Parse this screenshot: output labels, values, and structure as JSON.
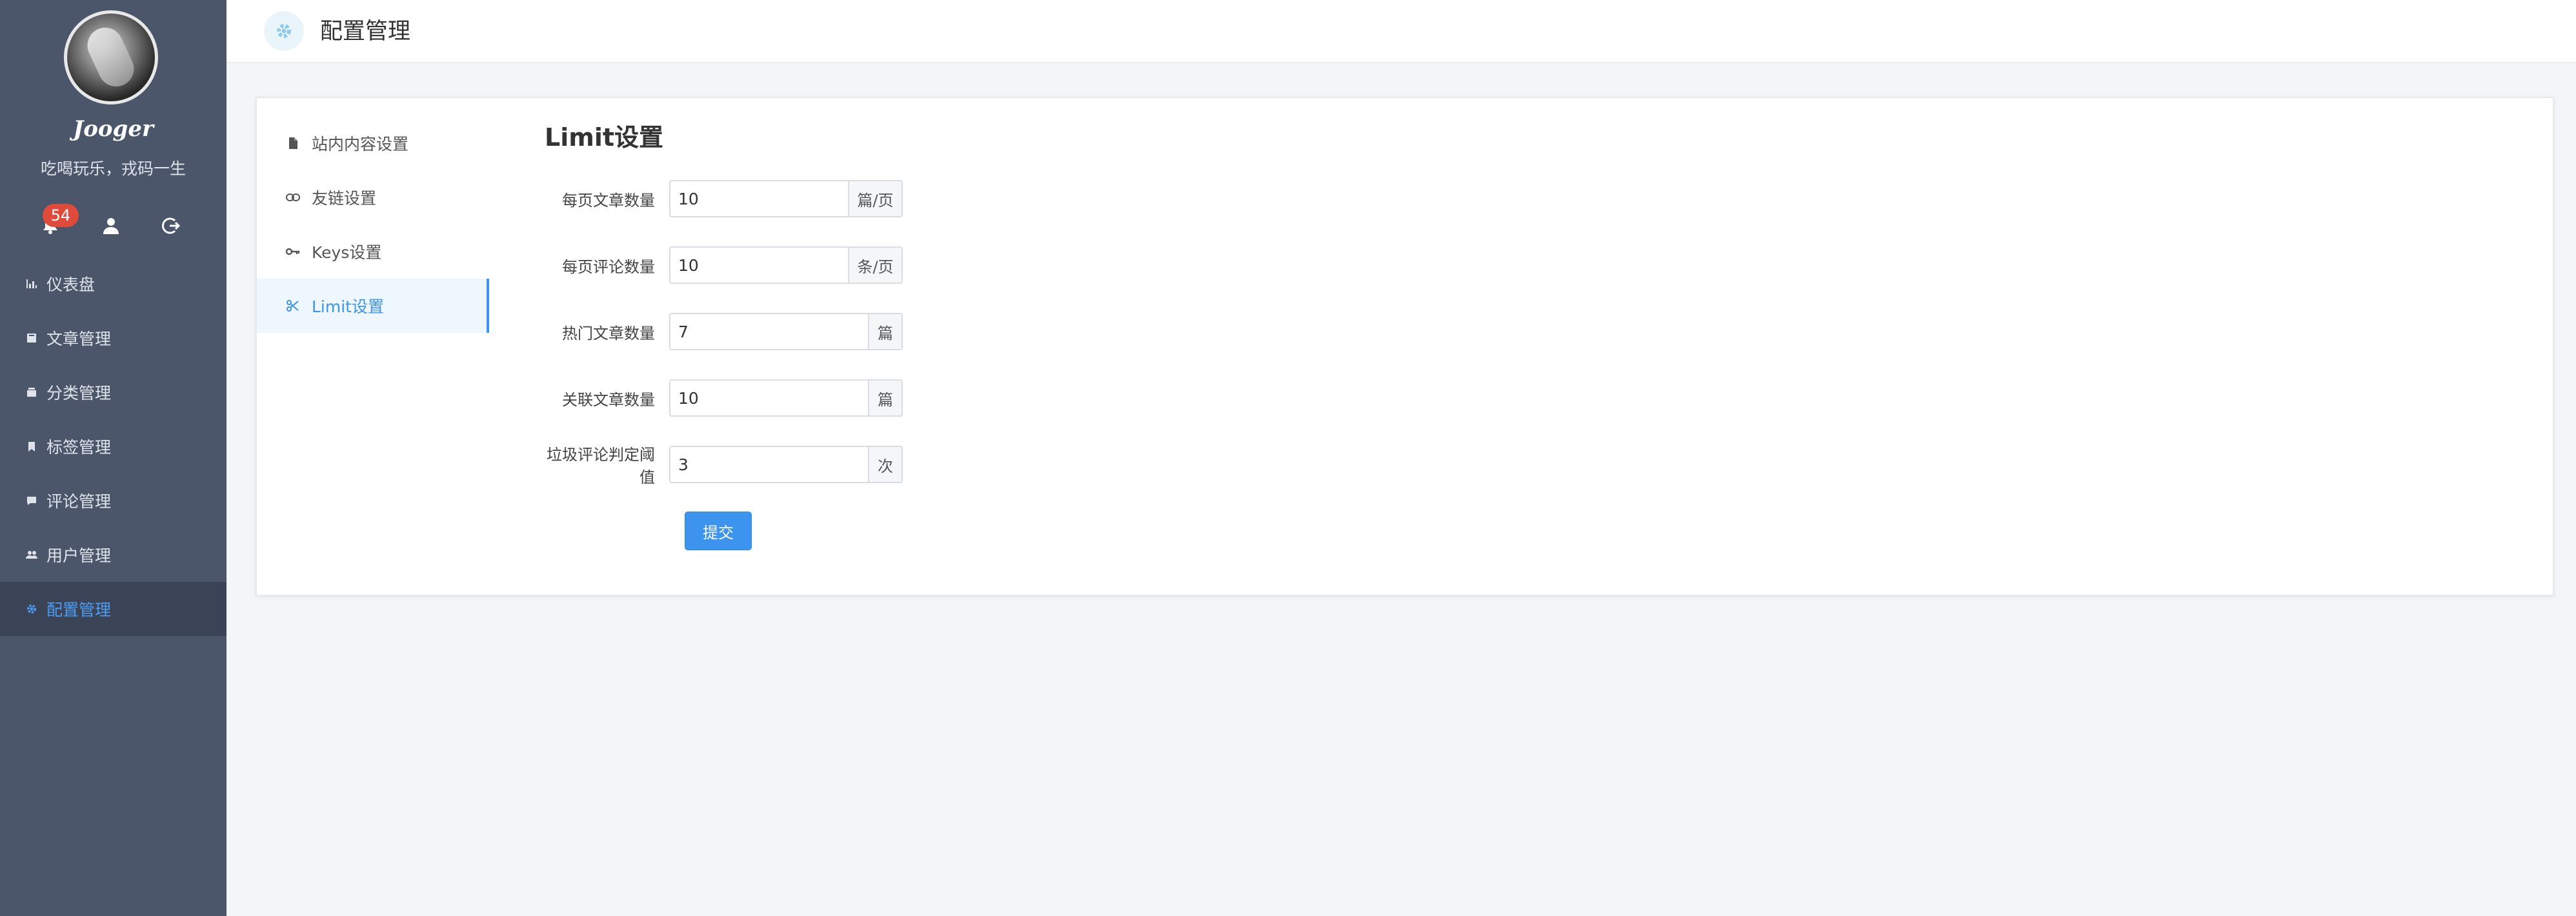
{
  "sidebar": {
    "username": "Jooger",
    "motto": "吃喝玩乐，戎码一生",
    "notification_count": "54",
    "nav": [
      {
        "label": "仪表盘",
        "icon": "bar-chart-icon"
      },
      {
        "label": "文章管理",
        "icon": "book-icon"
      },
      {
        "label": "分类管理",
        "icon": "folder-icon"
      },
      {
        "label": "标签管理",
        "icon": "bookmark-icon"
      },
      {
        "label": "评论管理",
        "icon": "comment-icon"
      },
      {
        "label": "用户管理",
        "icon": "users-icon"
      },
      {
        "label": "配置管理",
        "icon": "gear-icon",
        "active": true
      }
    ]
  },
  "header": {
    "title": "配置管理",
    "icon": "gear-icon"
  },
  "settings_nav": [
    {
      "label": "站内内容设置",
      "icon": "file-icon"
    },
    {
      "label": "友链设置",
      "icon": "link-icon"
    },
    {
      "label": "Keys设置",
      "icon": "key-icon"
    },
    {
      "label": "Limit设置",
      "icon": "scissors-icon",
      "active": true
    }
  ],
  "form": {
    "title": "Limit设置",
    "fields": [
      {
        "label": "每页文章数量",
        "value": "10",
        "unit": "篇/页"
      },
      {
        "label": "每页评论数量",
        "value": "10",
        "unit": "条/页"
      },
      {
        "label": "热门文章数量",
        "value": "7",
        "unit": "篇"
      },
      {
        "label": "关联文章数量",
        "value": "10",
        "unit": "篇"
      },
      {
        "label": "垃圾评论判定阈值",
        "value": "3",
        "unit": "次"
      }
    ],
    "submit_label": "提交"
  },
  "colors": {
    "sidebar_bg": "#4c566b",
    "accent": "#3d94ee",
    "badge": "#e04a3b"
  }
}
